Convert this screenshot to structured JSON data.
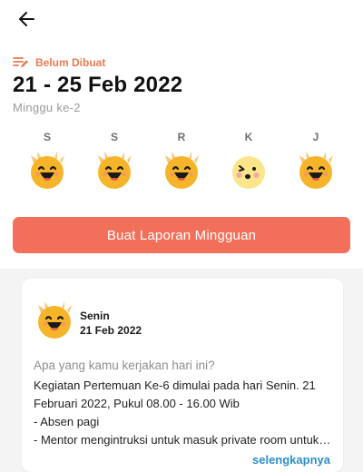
{
  "header": {
    "back_icon": "arrow-left-icon"
  },
  "report": {
    "status_icon": "list-edit-icon",
    "status_label": "Belum Dibuat",
    "date_range": "21 - 25 Feb 2022",
    "week_label": "Minggu ke-2"
  },
  "days": [
    {
      "letter": "S",
      "mood": "very-happy"
    },
    {
      "letter": "S",
      "mood": "very-happy"
    },
    {
      "letter": "R",
      "mood": "very-happy"
    },
    {
      "letter": "K",
      "mood": "neutral"
    },
    {
      "letter": "J",
      "mood": "very-happy"
    }
  ],
  "cta": {
    "label": "Buat Laporan Mingguan"
  },
  "daily_card": {
    "mood": "very-happy",
    "day": "Senin",
    "date": "21 Feb 2022",
    "question": "Apa yang kamu kerjakan hari ini?",
    "lines": [
      "Kegiatan Pertemuan Ke-6 dimulai pada hari Senin. 21",
      "Februari 2022, Pukul 08.00 - 16.00 Wib",
      "- Absen pagi",
      "- Mentor mengintruksi untuk masuk private room untuk memulai kelas"
    ],
    "more_label": "selengkapnya"
  },
  "colors": {
    "accent": "#f2705a",
    "status": "#e97a4f",
    "link": "#2c8ec9",
    "emoji_face": "#f6b42a"
  }
}
